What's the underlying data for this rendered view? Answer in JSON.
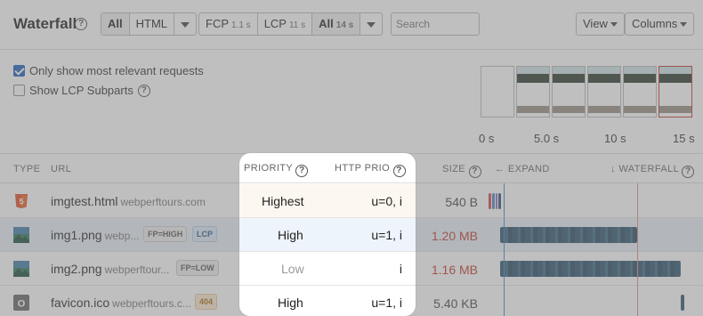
{
  "header": {
    "title": "Waterfall",
    "type_filter": [
      "All",
      "HTML"
    ],
    "timing_filter": [
      {
        "label": "FCP",
        "value": "1.1 s"
      },
      {
        "label": "LCP",
        "value": "11 s"
      },
      {
        "label": "All",
        "value": "14 s"
      }
    ],
    "search_placeholder": "Search",
    "view_label": "View",
    "columns_label": "Columns"
  },
  "options": {
    "relevant_label": "Only show most relevant requests",
    "relevant_checked": true,
    "lcp_subparts_label": "Show LCP Subparts",
    "lcp_subparts_checked": false
  },
  "filmstrip": {
    "labels": [
      "0 s",
      "5.0 s",
      "10 s",
      "15 s"
    ]
  },
  "table": {
    "columns": {
      "type": "TYPE",
      "url": "URL",
      "priority": "PRIORITY",
      "http_prio": "HTTP PRIO",
      "size": "SIZE",
      "expand": "← EXPAND",
      "waterfall": "↓ WATERFALL"
    },
    "rows": [
      {
        "name": "imgtest.html",
        "host": "webperftours.com",
        "tags": [],
        "priority": "Highest",
        "http_prio": "u=0, i",
        "size": "540 B",
        "icon": "html5-icon"
      },
      {
        "name": "img1.png",
        "host": "webp...",
        "tags": [
          "FP=HIGH",
          "LCP"
        ],
        "priority": "High",
        "http_prio": "u=1, i",
        "size": "1.20 MB",
        "icon": "image-icon"
      },
      {
        "name": "img2.png",
        "host": "webperftour...",
        "tags": [
          "FP=LOW"
        ],
        "priority": "Low",
        "http_prio": "i",
        "size": "1.16 MB",
        "icon": "image-icon"
      },
      {
        "name": "favicon.ico",
        "host": "webperftours.c...",
        "tags": [
          "404"
        ],
        "priority": "High",
        "http_prio": "u=1, i",
        "size": "5.40 KB",
        "icon": "other-file-icon"
      }
    ]
  },
  "colors": {
    "accent": "#1f5fbf",
    "waterfall_bar": "#2f5670",
    "large_size": "#c0392b",
    "lcp_line": "#e08b8b"
  }
}
